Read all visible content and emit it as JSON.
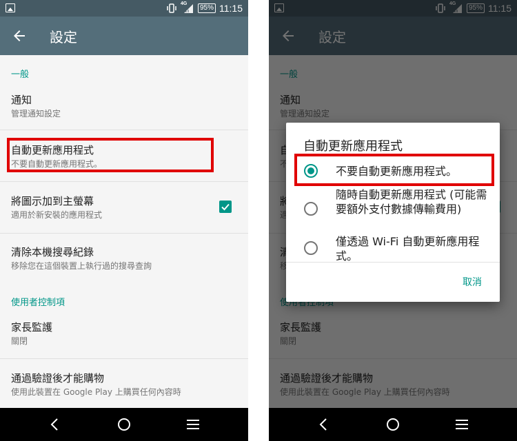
{
  "status_bar": {
    "time": "11:15",
    "battery": "95%",
    "network": "4G"
  },
  "app_bar": {
    "title": "設定"
  },
  "settings": {
    "section_general": "一般",
    "notifications": {
      "title": "通知",
      "subtitle": "管理通知設定"
    },
    "auto_update": {
      "title": "自動更新應用程式",
      "subtitle": "不要自動更新應用程式。"
    },
    "add_icon": {
      "title": "將圖示加到主螢幕",
      "subtitle": "適用於新安裝的應用程式",
      "checked": true
    },
    "clear_history": {
      "title": "清除本機搜尋紀錄",
      "subtitle": "移除您在這個裝置上執行過的搜尋查詢"
    },
    "section_user_controls": "使用者控制項",
    "parental_controls": {
      "title": "家長監護",
      "subtitle": "關閉"
    },
    "require_auth": {
      "title": "通過驗證後才能購物",
      "subtitle": "使用此裝置在 Google Play 上購買任何內容時"
    }
  },
  "dialog": {
    "title": "自動更新應用程式",
    "selected_index": 0,
    "options": [
      "不要自動更新應用程式。",
      "隨時自動更新應用程式 (可能需要額外支付數據傳輸費用)",
      "僅透過 Wi-Fi 自動更新應用程式。"
    ],
    "cancel_label": "取消"
  },
  "colors": {
    "status_bar": "#455a64",
    "app_bar": "#546e7a",
    "accent": "#009688",
    "highlight": "#e00000"
  },
  "icons": [
    "image-icon",
    "vibrate-icon",
    "signal-icon",
    "battery-icon",
    "back-arrow-icon",
    "checkbox-checked-icon",
    "nav-back-icon",
    "nav-home-icon",
    "nav-menu-icon"
  ]
}
